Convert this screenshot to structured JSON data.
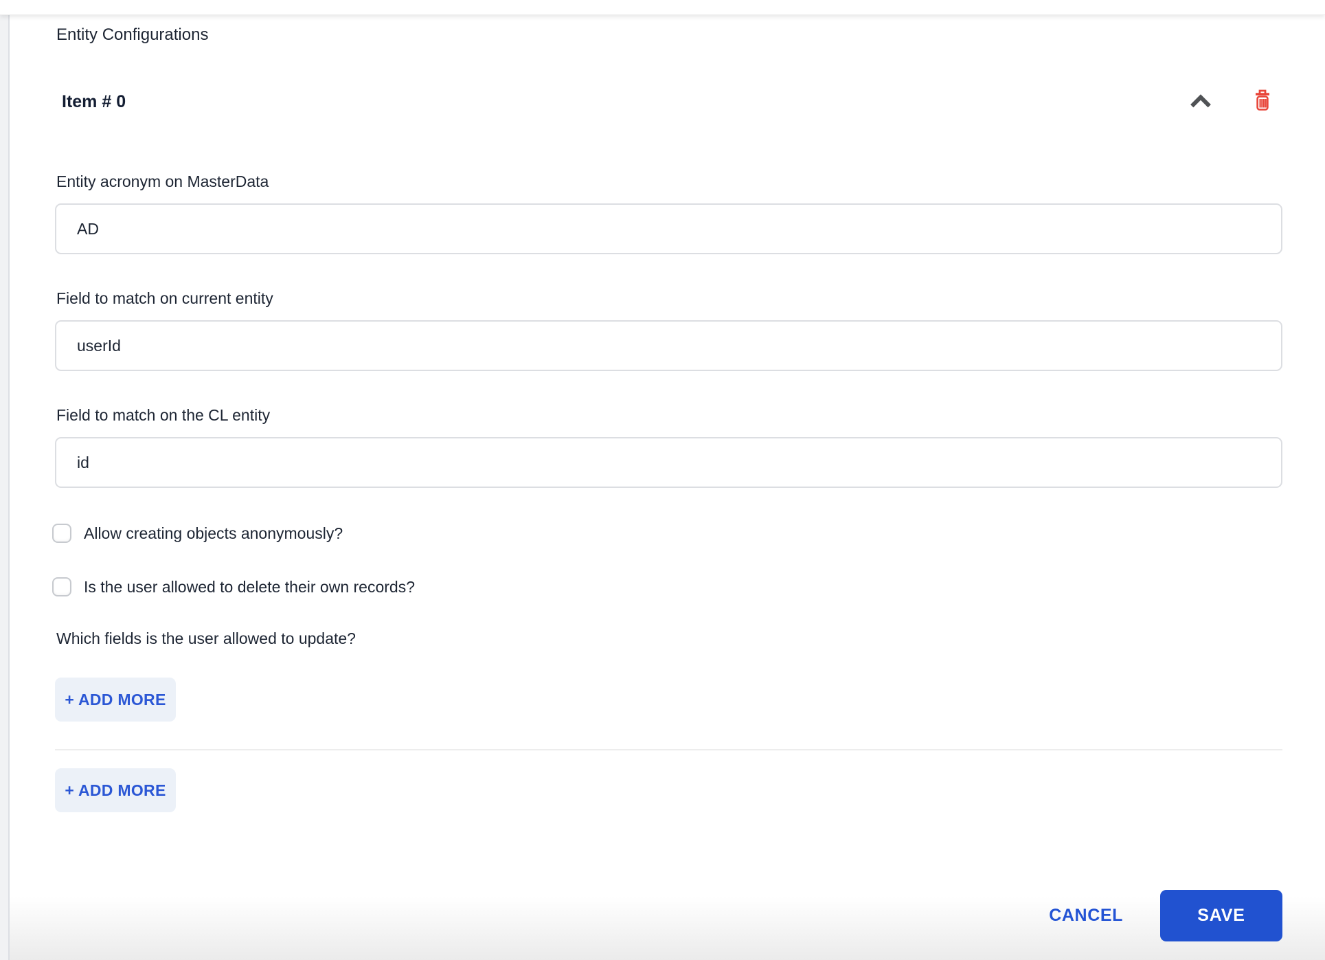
{
  "header": {
    "title": "Entity Configurations"
  },
  "item": {
    "title": "Item # 0"
  },
  "fields": [
    {
      "label": "Entity acronym on MasterData",
      "value": "AD"
    },
    {
      "label": "Field to match on current entity",
      "value": "userId"
    },
    {
      "label": "Field to match on the CL entity",
      "value": "id"
    }
  ],
  "checkboxes": [
    {
      "label": "Allow creating objects anonymously?",
      "checked": false
    },
    {
      "label": "Is the user allowed to delete their own records?",
      "checked": false
    }
  ],
  "questions": {
    "update_fields": "Which fields is the user allowed to update?"
  },
  "buttons": {
    "add_more_inner": "+ ADD MORE",
    "add_more_outer": "+ ADD MORE",
    "cancel": "CANCEL",
    "save": "SAVE"
  },
  "icons": {
    "collapse": "chevron-up-icon",
    "delete": "trash-icon"
  },
  "colors": {
    "primary_blue": "#2152d0",
    "link_blue": "#2b57d5",
    "add_more_bg": "#ecf1f8",
    "danger_red": "#e84539",
    "text_dark": "#1d2533",
    "input_border": "#dcdee2",
    "divider": "#ededed"
  }
}
